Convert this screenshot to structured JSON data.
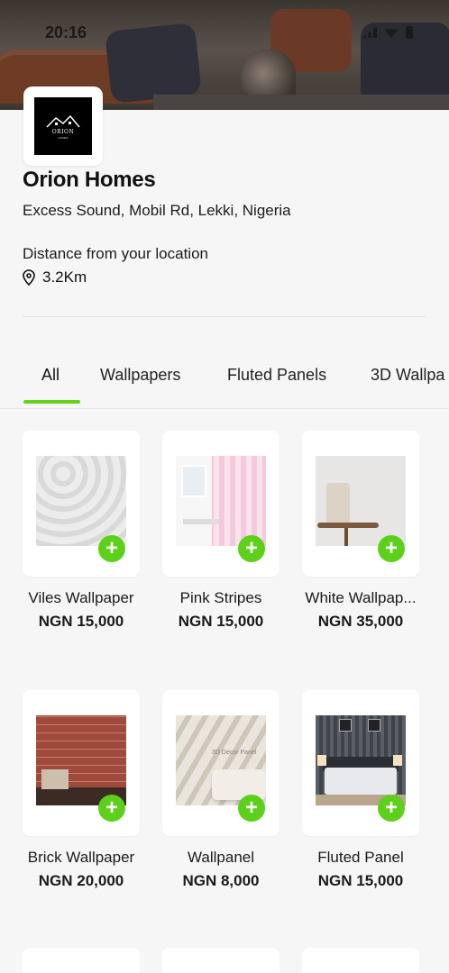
{
  "status_bar": {
    "time": "20:16"
  },
  "store": {
    "name": "Orion Homes",
    "address": "Excess Sound, Mobil Rd, Lekki, Nigeria",
    "distance_label": "Distance from your location",
    "distance_value": "3.2Km",
    "logo_text": "ORION",
    "logo_sub": "HOMES"
  },
  "tabs": [
    {
      "label": "All",
      "active": true
    },
    {
      "label": "Wallpapers",
      "active": false
    },
    {
      "label": "Fluted Panels",
      "active": false
    },
    {
      "label": "3D Wallpa",
      "active": false
    }
  ],
  "products": [
    {
      "name": "Viles Wallpaper",
      "price": "NGN 15,000",
      "image": "viles"
    },
    {
      "name": "Pink Stripes",
      "price": "NGN 15,000",
      "image": "pink"
    },
    {
      "name": "White Wallpap...",
      "price": "NGN 35,000",
      "image": "white"
    },
    {
      "name": "Brick Wallpaper",
      "price": "NGN 20,000",
      "image": "brick"
    },
    {
      "name": "Wallpanel",
      "price": "NGN 8,000",
      "image": "wallpanel",
      "image_text": "3D Decor Panel"
    },
    {
      "name": "Fluted Panel",
      "price": "NGN 15,000",
      "image": "fluted"
    }
  ],
  "add_button_symbol": "+",
  "colors": {
    "accent": "#5cd01a",
    "tab_underline": "#67d11c"
  },
  "icons": {
    "location": "map-pin-icon",
    "add": "plus-icon"
  }
}
